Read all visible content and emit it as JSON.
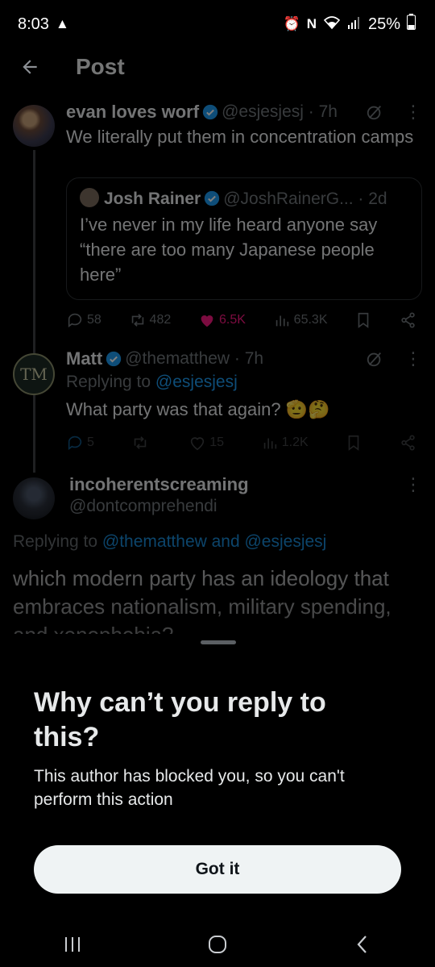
{
  "status": {
    "time": "8:03",
    "battery": "25%"
  },
  "header": {
    "title": "Post"
  },
  "tweet1": {
    "name": "evan loves worf",
    "meta": "@esjesjesj · 7h",
    "text": "We literally put them in concentration camps",
    "quote": {
      "name": "Josh Rainer",
      "meta": "@JoshRainerG... · 2d",
      "text": "I’ve never in my life heard anyone say “there are too many Japanese people here”"
    },
    "stats": {
      "replies": "58",
      "reposts": "482",
      "likes": "6.5K",
      "views": "65.3K"
    }
  },
  "tweet2": {
    "name": "Matt",
    "meta": "@thematthew · 7h",
    "replying_prefix": "Replying to ",
    "replying_handle": "@esjesjesj",
    "text": "What party was that again? 🫡🤔",
    "stats": {
      "replies": "5",
      "reposts": "",
      "likes": "15",
      "views": "1.2K"
    }
  },
  "tweet3": {
    "name": "incoherentscreaming",
    "handle": "@dontcomprehendi",
    "replying_prefix": "Replying to ",
    "replying_handles": "@thematthew and @esjesjesj",
    "text": "which modern party has an ideology that embraces nationalism, military spending, and xenophobia?"
  },
  "sheet": {
    "title": "Why can’t you reply to this?",
    "description": "This author has blocked you, so you can't perform this action",
    "button": "Got it"
  },
  "colors": {
    "accent": "#1d9bf0",
    "like": "#f91880",
    "background": "#000000"
  }
}
